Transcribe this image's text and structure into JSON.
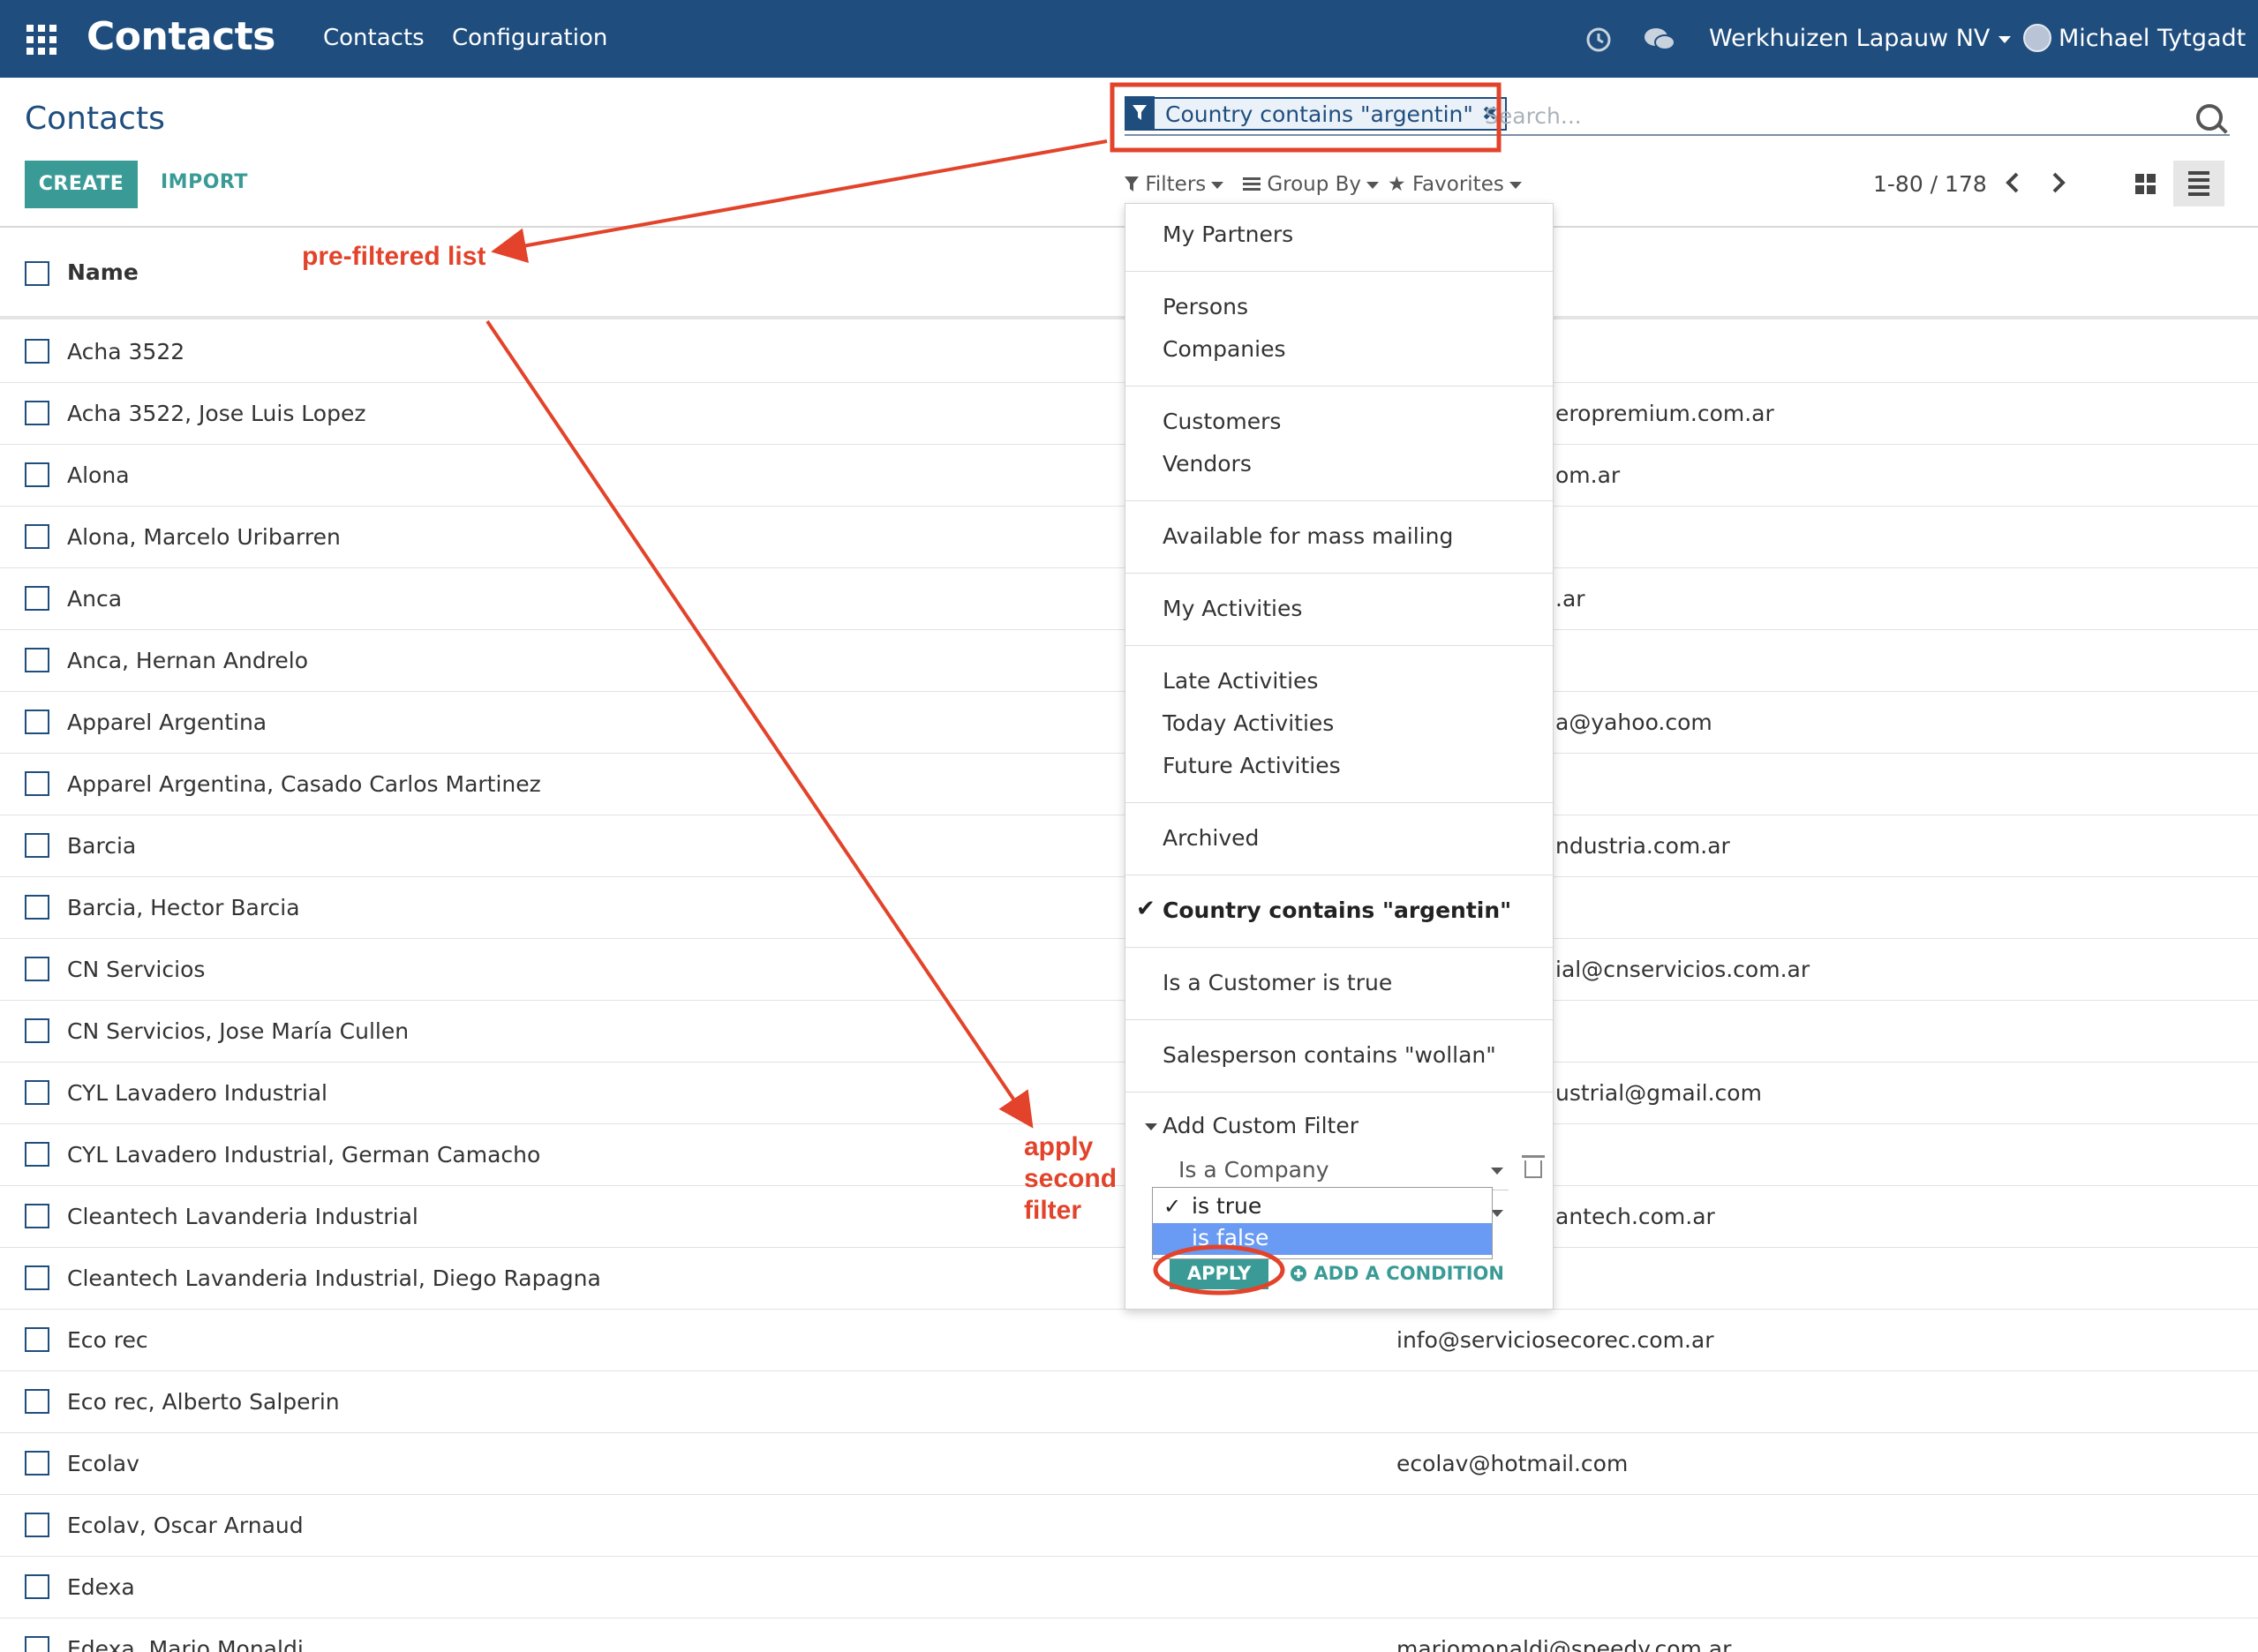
{
  "navbar": {
    "brand": "Contacts",
    "links": [
      "Contacts",
      "Configuration"
    ],
    "company": "Werkhuizen Lapauw NV",
    "user": "Michael Tytgadt"
  },
  "control_panel": {
    "title": "Contacts",
    "create_label": "CREATE",
    "import_label": "IMPORT",
    "search": {
      "facet_label": "Country contains \"argentin\"",
      "facet_remove": "✖",
      "placeholder": "Search..."
    },
    "filters_label": "Filters",
    "group_by_label": "Group By",
    "favorites_label": "Favorites",
    "pager": "1-80 / 178"
  },
  "list": {
    "column_name": "Name",
    "rows": [
      {
        "name": "Acha 3522",
        "email": ""
      },
      {
        "name": "Acha 3522, Jose Luis Lopez",
        "email": "eropremium.com.ar"
      },
      {
        "name": "Alona",
        "email": "om.ar"
      },
      {
        "name": "Alona, Marcelo Uribarren",
        "email": ""
      },
      {
        "name": "Anca",
        "email": ".ar"
      },
      {
        "name": "Anca, Hernan Andrelo",
        "email": ""
      },
      {
        "name": "Apparel Argentina",
        "email": "a@yahoo.com"
      },
      {
        "name": "Apparel Argentina, Casado Carlos Martinez",
        "email": ""
      },
      {
        "name": "Barcia",
        "email": "ndustria.com.ar"
      },
      {
        "name": "Barcia, Hector Barcia",
        "email": ""
      },
      {
        "name": "CN Servicios",
        "email": "ial@cnservicios.com.ar"
      },
      {
        "name": "CN Servicios, Jose María Cullen",
        "email": ""
      },
      {
        "name": "CYL Lavadero Industrial",
        "email": "ustrial@gmail.com"
      },
      {
        "name": "CYL Lavadero Industrial, German Camacho",
        "email": ""
      },
      {
        "name": "Cleantech Lavanderia Industrial",
        "email": "antech.com.ar"
      },
      {
        "name": "Cleantech Lavanderia Industrial, Diego Rapagna",
        "email": ""
      },
      {
        "name": "Eco rec",
        "email": "info@serviciosecorec.com.ar"
      },
      {
        "name": "Eco rec, Alberto Salperin",
        "email": ""
      },
      {
        "name": "Ecolav",
        "email": "ecolav@hotmail.com"
      },
      {
        "name": "Ecolav, Oscar Arnaud",
        "email": ""
      },
      {
        "name": "Edexa",
        "email": ""
      },
      {
        "name": "Edexa, Mario Monaldi",
        "email": "mariomonaldi@speedy.com.ar"
      }
    ]
  },
  "filters_dropdown": {
    "groups": [
      [
        "My Partners"
      ],
      [
        "Persons",
        "Companies"
      ],
      [
        "Customers",
        "Vendors"
      ],
      [
        "Available for mass mailing"
      ],
      [
        "My Activities"
      ],
      [
        "Late Activities",
        "Today Activities",
        "Future Activities"
      ],
      [
        "Archived"
      ],
      [
        "Country contains \"argentin\""
      ],
      [
        "Is a Customer is true"
      ],
      [
        "Salesperson contains \"wollan\""
      ]
    ],
    "active_item": "Country contains \"argentin\"",
    "custom_filter": {
      "toggle_label": "Add Custom Filter",
      "field": "Is a Company",
      "options": [
        "is true",
        "is false"
      ],
      "selected_option": "is true",
      "highlighted_option": "is false",
      "apply_label": "APPLY",
      "add_condition_label": "ADD A CONDITION"
    }
  },
  "annotations": {
    "prefiltered": "pre-filtered list",
    "apply_second": [
      "apply",
      "second",
      "filter"
    ],
    "color": "#e2432a"
  },
  "colors": {
    "navbar": "#1f4e7e",
    "primary_button": "#3a9b96",
    "highlight_option": "#6a9bf4"
  }
}
